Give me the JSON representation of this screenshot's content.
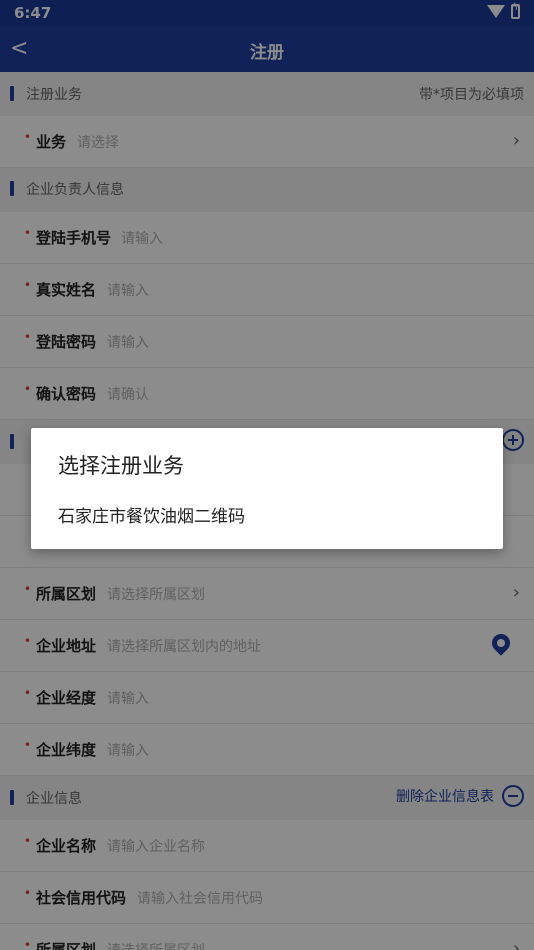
{
  "status_bar": {
    "time": "6:47",
    "icons": [
      "wifi-icon",
      "battery-charging-icon"
    ]
  },
  "app_bar": {
    "back": "<",
    "title": "注册"
  },
  "sections": {
    "business": {
      "label": "注册业务",
      "right": "带*项目为必填项"
    },
    "owner": {
      "label": "企业负责人信息"
    },
    "enterprise_info": {
      "label": "企业信息",
      "right": "删除企业信息表"
    }
  },
  "rows": {
    "business": {
      "star": "•",
      "label": "业务",
      "placeholder": "请选择"
    },
    "phone": {
      "star": "•",
      "label": "登陆手机号",
      "placeholder": "请输入"
    },
    "realname": {
      "star": "•",
      "label": "真实姓名",
      "placeholder": "请输入"
    },
    "password": {
      "star": "•",
      "label": "登陆密码",
      "placeholder": "请输入"
    },
    "confirm": {
      "star": "•",
      "label": "确认密码",
      "placeholder": "请确认"
    },
    "district": {
      "star": "•",
      "label": "所属区划",
      "placeholder": "请选择所属区划"
    },
    "address": {
      "star": "•",
      "label": "企业地址",
      "placeholder": "请选择所属区划内的地址"
    },
    "longitude": {
      "star": "•",
      "label": "企业经度",
      "placeholder": "请输入"
    },
    "latitude": {
      "star": "•",
      "label": "企业纬度",
      "placeholder": "请输入"
    },
    "company_name": {
      "star": "•",
      "label": "企业名称",
      "placeholder": "请输入企业名称"
    },
    "credit_code": {
      "star": "•",
      "label": "社会信用代码",
      "placeholder": "请输入社会信用代码"
    },
    "district2": {
      "star": "•",
      "label": "所属区划",
      "placeholder": "请选择所属区划"
    }
  },
  "dialog": {
    "title": "选择注册业务",
    "options": [
      "石家庄市餐饮油烟二维码"
    ]
  },
  "colors": {
    "primary": "#1f3fa0",
    "required": "#e53935"
  }
}
